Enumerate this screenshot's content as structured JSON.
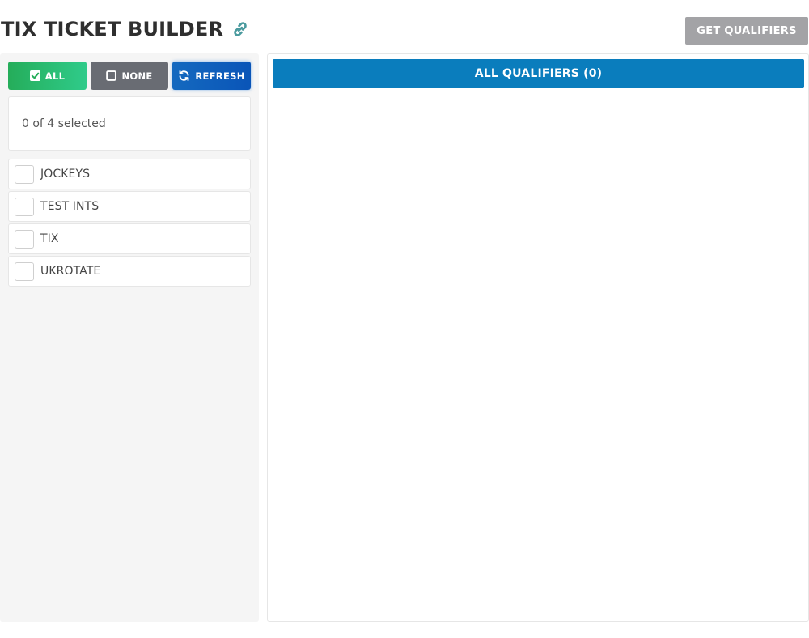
{
  "header": {
    "title": "TIX TICKET BUILDER",
    "link_icon": "link-icon",
    "get_qualifiers_label": "GET QUALIFIERS"
  },
  "left_panel": {
    "buttons": {
      "all_label": "ALL",
      "none_label": "NONE",
      "refresh_label": "REFRESH"
    },
    "summary": "0 of 4 selected",
    "items": [
      {
        "label": "JOCKEYS",
        "checked": false
      },
      {
        "label": "TEST INTS",
        "checked": false
      },
      {
        "label": "TIX",
        "checked": false
      },
      {
        "label": "UKROTATE",
        "checked": false
      }
    ]
  },
  "right_panel": {
    "qualifiers_header": "ALL QUALIFIERS (0)"
  },
  "colors": {
    "all_button": "#25ad5a",
    "none_button": "#696c73",
    "refresh_button": "#1469bf",
    "qualifiers_bar": "#0a7dbd",
    "get_qualifiers_button": "#a3a3a6",
    "link_icon": "#4a9a9e"
  }
}
